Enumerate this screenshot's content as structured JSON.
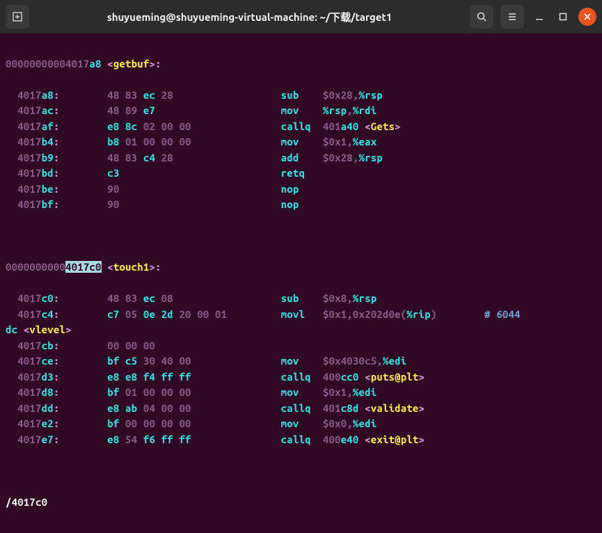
{
  "header": {
    "title": "shuyueming@shuyueming-virtual-machine: ~/下载/target1"
  },
  "disasm": {
    "func1": {
      "addr_prefix": "00000000004017",
      "addr_suffix": "a8",
      "label_open": "<",
      "label_name": "getbuf",
      "label_close": ">:"
    },
    "lines1": [
      {
        "addr_p": "4017",
        "addr_s": "a8",
        "colon": ":",
        "bytes_pre": "48 83 ",
        "bytes_hi": "ec",
        "bytes_post": " 28",
        "mnemonic": "sub",
        "op": "$0x28,",
        "reg": "%rsp"
      },
      {
        "addr_p": "4017",
        "addr_s": "ac",
        "colon": ":",
        "bytes_pre": "48 89 ",
        "bytes_hi": "e7",
        "bytes_post": "",
        "mnemonic": "mov",
        "op": "",
        "reg": "%rsp",
        "op2": ",",
        "reg2": "%rdi"
      },
      {
        "addr_p": "4017",
        "addr_s": "af",
        "colon": ":",
        "bytes_pre": "",
        "bytes_hi": "e8 8c",
        "bytes_post": " 02 00 00",
        "mnemonic": "callq",
        "op": "401",
        "reg": "a40 ",
        "tail_sym": "<",
        "tail_name": "Gets",
        "tail_close": ">"
      },
      {
        "addr_p": "4017",
        "addr_s": "b4",
        "colon": ":",
        "bytes_pre": "",
        "bytes_hi": "b8",
        "bytes_post": " 01 00 00 00",
        "mnemonic": "mov",
        "op": "$0x1,",
        "reg": "%eax"
      },
      {
        "addr_p": "4017",
        "addr_s": "b9",
        "colon": ":",
        "bytes_pre": "48 83 ",
        "bytes_hi": "c4",
        "bytes_post": " 28",
        "mnemonic": "add",
        "op": "$0x28,",
        "reg": "%rsp"
      },
      {
        "addr_p": "4017",
        "addr_s": "bd",
        "colon": ":",
        "bytes_pre": "",
        "bytes_hi": "c3",
        "bytes_post": "",
        "mnemonic": "retq",
        "op": "",
        "reg": ""
      },
      {
        "addr_p": "4017",
        "addr_s": "be",
        "colon": ":",
        "bytes_pre": "90",
        "bytes_hi": "",
        "bytes_post": "",
        "mnemonic": "nop",
        "op": "",
        "reg": ""
      },
      {
        "addr_p": "4017",
        "addr_s": "bf",
        "colon": ":",
        "bytes_pre": "90",
        "bytes_hi": "",
        "bytes_post": "",
        "mnemonic": "nop",
        "op": "",
        "reg": ""
      }
    ],
    "func2": {
      "addr_prefix": "0000000000",
      "addr_hl": "4017c0",
      "space": " ",
      "label_open": "<",
      "label_name": "touch1",
      "label_close": ">:"
    },
    "lines2": [
      {
        "addr_p": "4017",
        "addr_s": "c0",
        "colon": ":",
        "bytes_pre": "48 83 ",
        "bytes_hi": "ec",
        "bytes_post": " 08",
        "mnemonic": "sub",
        "op": "$0x8,",
        "reg": "%rsp"
      },
      {
        "addr_p": "4017",
        "addr_s": "c4",
        "colon": ":",
        "bytes_pre": "",
        "bytes_hi": "c7",
        "bytes_post": " 05 ",
        "bytes_hi2": "0e 2d",
        "bytes_post2": " 20 00 01",
        "mnemonic": "movl",
        "op": "$0x1,0x202d0e(",
        "reg": "%rip",
        "op2": ")",
        "comment": "        # 6044"
      },
      {
        "cont_pre": "dc ",
        "cont_sym": "<",
        "cont_name": "vlevel",
        "cont_close": ">"
      },
      {
        "addr_p": "4017",
        "addr_s": "cb",
        "colon": ":",
        "bytes_pre": "00 00 00",
        "bytes_hi": "",
        "bytes_post": "",
        "mnemonic": "",
        "op": "",
        "reg": ""
      },
      {
        "addr_p": "4017",
        "addr_s": "ce",
        "colon": ":",
        "bytes_pre": "",
        "bytes_hi": "bf c5",
        "bytes_post": " 30 40 00",
        "mnemonic": "mov",
        "op": "$0x4030c5,",
        "reg": "%edi"
      },
      {
        "addr_p": "4017",
        "addr_s": "d3",
        "colon": ":",
        "bytes_pre": "",
        "bytes_hi": "e8 e8 f4 ff ff",
        "bytes_post": "",
        "mnemonic": "callq",
        "op": "400",
        "reg": "cc0 ",
        "tail_sym": "<",
        "tail_name": "puts@plt",
        "tail_close": ">"
      },
      {
        "addr_p": "4017",
        "addr_s": "d8",
        "colon": ":",
        "bytes_pre": "",
        "bytes_hi": "bf",
        "bytes_post": " 01 00 00 00",
        "mnemonic": "mov",
        "op": "$0x1,",
        "reg": "%edi"
      },
      {
        "addr_p": "4017",
        "addr_s": "dd",
        "colon": ":",
        "bytes_pre": "",
        "bytes_hi": "e8 ab",
        "bytes_post": " 04 00 00",
        "mnemonic": "callq",
        "op": "401",
        "reg": "c8d ",
        "tail_sym": "<",
        "tail_name": "validate",
        "tail_close": ">"
      },
      {
        "addr_p": "4017",
        "addr_s": "e2",
        "colon": ":",
        "bytes_pre": "",
        "bytes_hi": "bf",
        "bytes_post": " 00 00 00 00",
        "mnemonic": "mov",
        "op": "$0x0,",
        "reg": "%edi"
      },
      {
        "addr_p": "4017",
        "addr_s": "e7",
        "colon": ":",
        "bytes_pre": "",
        "bytes_hi": "e8",
        "bytes_post": " 54 ",
        "bytes_hi2": "f6 ff ff",
        "bytes_post2": "",
        "mnemonic": "callq",
        "op": "400",
        "reg": "e40 ",
        "tail_sym": "<",
        "tail_name": "exit@plt",
        "tail_close": ">"
      }
    ]
  },
  "search": {
    "text": "/4017c0"
  }
}
